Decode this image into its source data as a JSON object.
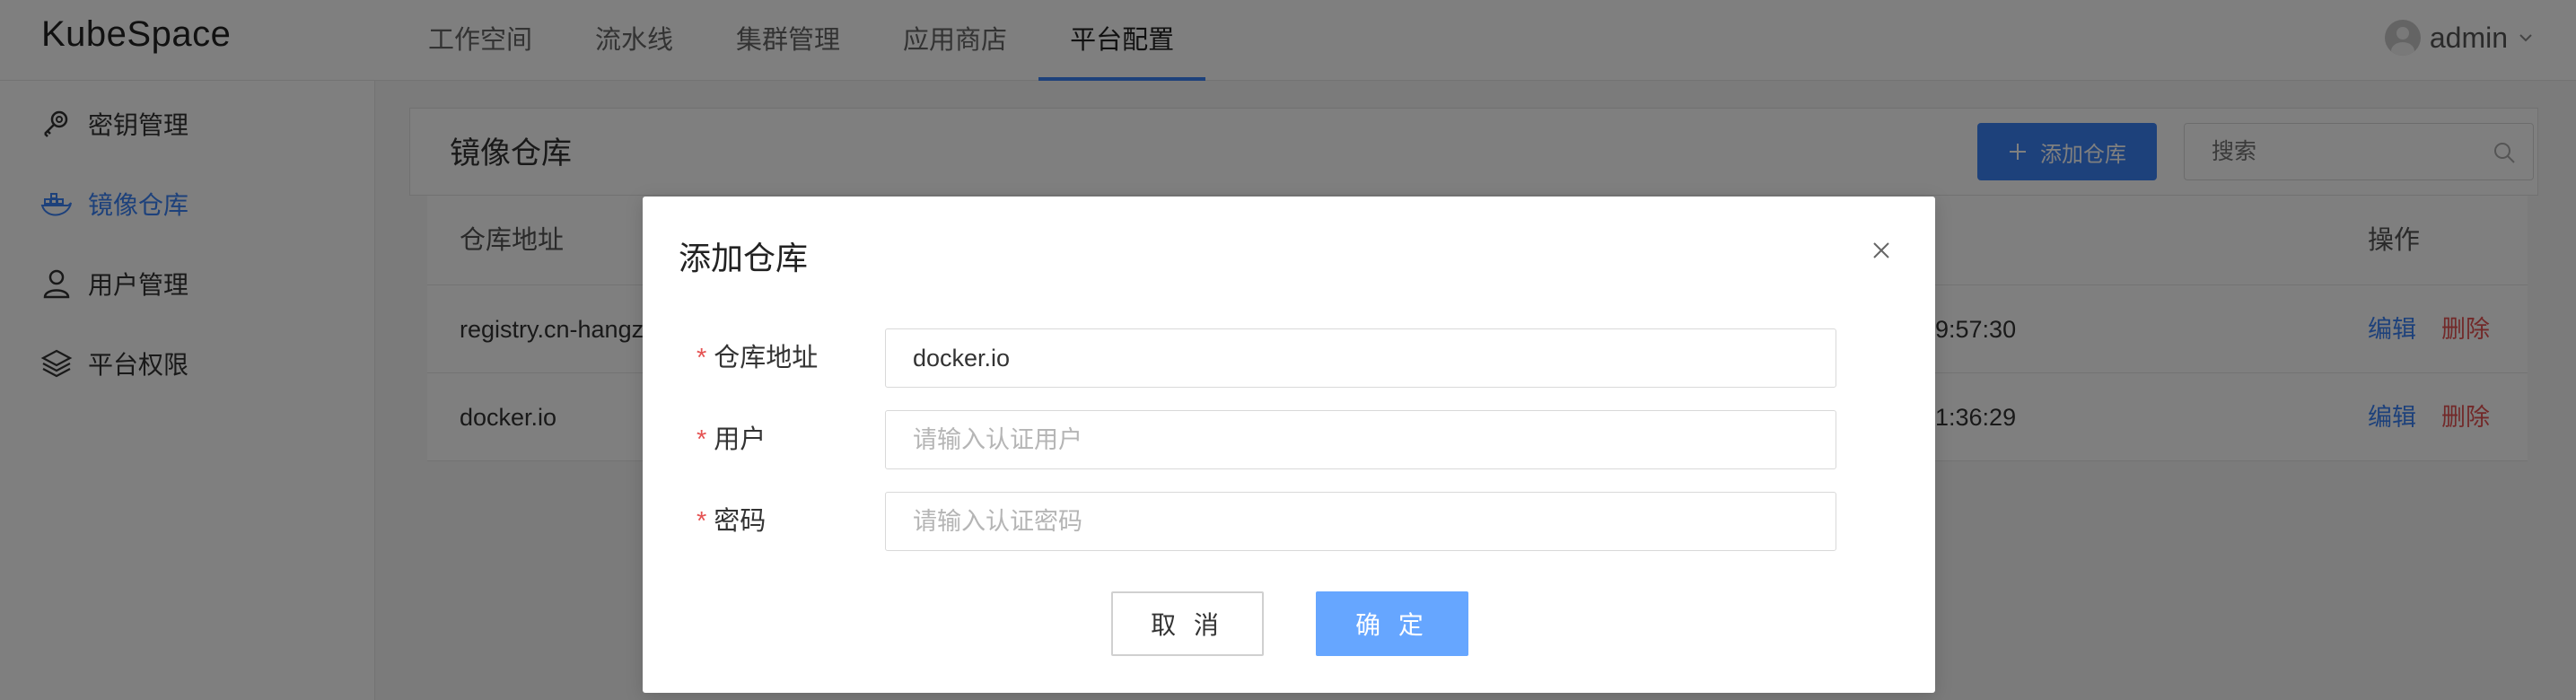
{
  "app": {
    "logo": "KubeSpace"
  },
  "nav": {
    "items": [
      "工作空间",
      "流水线",
      "集群管理",
      "应用商店",
      "平台配置"
    ],
    "active_index": 4
  },
  "user": {
    "name": "admin",
    "icon": "chevron-down-icon"
  },
  "sidebar": {
    "items": [
      {
        "label": "密钥管理",
        "icon": "key-icon"
      },
      {
        "label": "镜像仓库",
        "icon": "docker-icon"
      },
      {
        "label": "用户管理",
        "icon": "user-icon"
      },
      {
        "label": "平台权限",
        "icon": "layers-icon"
      }
    ],
    "active_index": 1
  },
  "page": {
    "title": "镜像仓库",
    "add_button": "添加仓库",
    "search_placeholder": "搜索"
  },
  "table": {
    "columns": {
      "address": "仓库地址",
      "actions": "操作"
    },
    "rows": [
      {
        "address": "registry.cn-hangzl",
        "time_partial": "9:57:30",
        "edit": "编辑",
        "delete": "删除"
      },
      {
        "address": "docker.io",
        "time_partial": "1:36:29",
        "edit": "编辑",
        "delete": "删除"
      }
    ]
  },
  "dialog": {
    "title": "添加仓库",
    "fields": {
      "address": {
        "label": "仓库地址",
        "value": "docker.io",
        "placeholder": ""
      },
      "user": {
        "label": "用户",
        "value": "",
        "placeholder": "请输入认证用户"
      },
      "password": {
        "label": "密码",
        "value": "",
        "placeholder": "请输入认证密码"
      }
    },
    "cancel": "取 消",
    "confirm": "确 定"
  },
  "colors": {
    "primary": "#3b82f6",
    "danger": "#e55353",
    "confirm": "#66a6ff"
  }
}
